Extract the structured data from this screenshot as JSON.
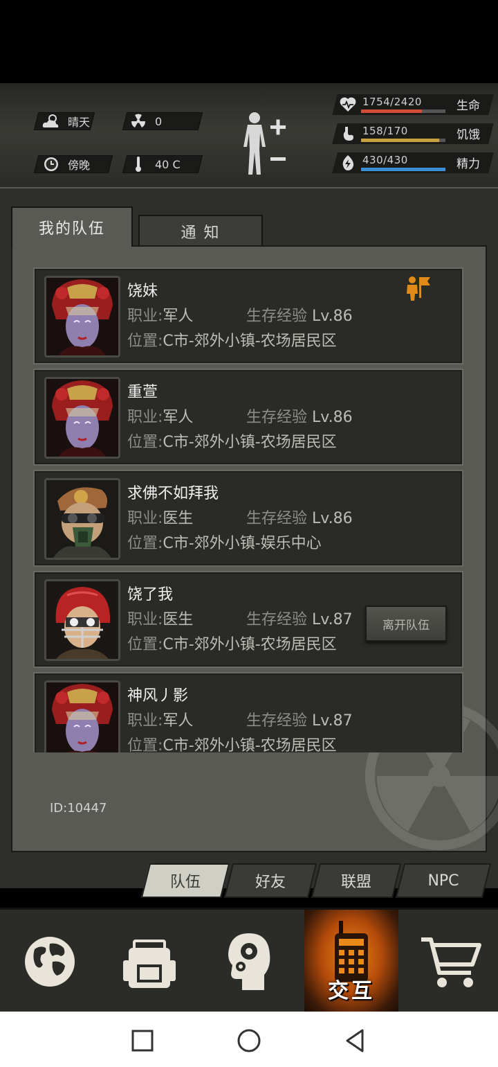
{
  "hud": {
    "weather": "晴天",
    "radiation": "0",
    "time_of_day": "傍晚",
    "temperature": "40 C",
    "stats": [
      {
        "value": "1754/2420",
        "label": "生命",
        "fill": 0.725,
        "color": "#d14c3a",
        "icon": "heart-icon"
      },
      {
        "value": "158/170",
        "label": "饥饿",
        "fill": 0.93,
        "color": "#c9a040",
        "icon": "stomach-icon"
      },
      {
        "value": "430/430",
        "label": "精力",
        "fill": 1.0,
        "color": "#3a8fd6",
        "icon": "energy-icon"
      }
    ]
  },
  "tabs": {
    "my_team": "我的队伍",
    "notice": "通 知"
  },
  "members": [
    {
      "name": "饶妹",
      "job_label": "职业:",
      "job": "军人",
      "exp_label": "生存经验",
      "level": "Lv.86",
      "loc_label": "位置:",
      "location": "C市-郊外小镇-农场居民区",
      "avatar": "opera-woman",
      "leader": true
    },
    {
      "name": "重萱",
      "job_label": "职业:",
      "job": "军人",
      "exp_label": "生存经验",
      "level": "Lv.86",
      "loc_label": "位置:",
      "location": "C市-郊外小镇-农场居民区",
      "avatar": "opera-woman",
      "leader": false
    },
    {
      "name": "求佛不如拜我",
      "job_label": "职业:",
      "job": "医生",
      "exp_label": "生存经验",
      "level": "Lv.86",
      "loc_label": "位置:",
      "location": "C市-郊外小镇-娱乐中心",
      "avatar": "gasmask-man",
      "leader": false
    },
    {
      "name": "饶了我",
      "job_label": "职业:",
      "job": "医生",
      "exp_label": "生存经验",
      "level": "Lv.87",
      "loc_label": "位置:",
      "location": "C市-郊外小镇-农场居民区",
      "avatar": "helmet-man",
      "leader": false,
      "action": "离开队伍"
    },
    {
      "name": "神风丿影",
      "job_label": "职业:",
      "job": "军人",
      "exp_label": "生存经验",
      "level": "Lv.87",
      "loc_label": "位置:",
      "location": "C市-郊外小镇-农场居民区",
      "avatar": "opera-woman",
      "leader": false
    }
  ],
  "player_id": "ID:10447",
  "subtabs": [
    "队伍",
    "好友",
    "联盟",
    "NPC"
  ],
  "nav": {
    "items": [
      "globe-icon",
      "backpack-icon",
      "skills-head-icon",
      "walkie-talkie-icon",
      "cart-icon"
    ],
    "active_label": "交互"
  }
}
